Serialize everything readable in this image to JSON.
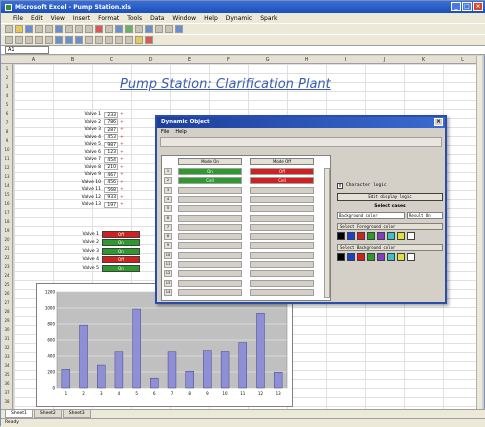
{
  "window": {
    "title": "Microsoft Excel - Pump Station.xls"
  },
  "menubar": [
    "File",
    "Edit",
    "View",
    "Insert",
    "Format",
    "Tools",
    "Data",
    "Window",
    "Help",
    "Dynamic",
    "Spark"
  ],
  "formula": {
    "namebox": "A1"
  },
  "columns": [
    "A",
    "B",
    "C",
    "D",
    "E",
    "F",
    "G",
    "H",
    "I",
    "J",
    "K",
    "L"
  ],
  "sheet": {
    "title": "Pump Station: Clarification Plant",
    "values": [
      {
        "label": "Valve 1",
        "value": "233",
        "mark": "+"
      },
      {
        "label": "Valve 2",
        "value": "786",
        "mark": "+"
      },
      {
        "label": "Valve 3",
        "value": "287",
        "mark": "+"
      },
      {
        "label": "Valve 4",
        "value": "453",
        "mark": "+"
      },
      {
        "label": "Valve 5",
        "value": "987",
        "mark": "+"
      },
      {
        "label": "Valve 6",
        "value": "123",
        "mark": "+"
      },
      {
        "label": "Valve 7",
        "value": "454",
        "mark": "+"
      },
      {
        "label": "Valve 8",
        "value": "210",
        "mark": "+"
      },
      {
        "label": "Valve 9",
        "value": "467",
        "mark": "+"
      },
      {
        "label": "Valve 10",
        "value": "456",
        "mark": "+"
      },
      {
        "label": "Valve 11",
        "value": "568",
        "mark": "+"
      },
      {
        "label": "Valve 12",
        "value": "933",
        "mark": "+"
      },
      {
        "label": "Valve 13",
        "value": "197",
        "mark": "+"
      }
    ],
    "statuses": [
      {
        "label": "Valve 1",
        "text": "Off",
        "color": "#d02020"
      },
      {
        "label": "Valve 2",
        "text": "On",
        "color": "#2e9a2e"
      },
      {
        "label": "Valve 3",
        "text": "On",
        "color": "#2e9a2e"
      },
      {
        "label": "Valve 4",
        "text": "Off",
        "color": "#d02020"
      },
      {
        "label": "Valve 5",
        "text": "On",
        "color": "#2e9a2e"
      }
    ]
  },
  "chart_data": {
    "type": "bar",
    "categories": [
      "1",
      "2",
      "3",
      "4",
      "5",
      "6",
      "7",
      "8",
      "9",
      "10",
      "11",
      "12",
      "13"
    ],
    "values": [
      233,
      786,
      287,
      453,
      987,
      123,
      454,
      210,
      467,
      456,
      568,
      933,
      197
    ],
    "ylim": [
      0,
      1200
    ],
    "yticks": [
      "0",
      "100",
      "200",
      "300",
      "400",
      "500",
      "600",
      "700",
      "800",
      "900",
      "1000",
      "1100",
      "1200"
    ],
    "bar_color": "#8f8fd8",
    "plot_bg": "#c0c0c0",
    "grid": true
  },
  "dialog": {
    "title": "Dynamic Object",
    "menu": [
      "File",
      "Help"
    ],
    "col1_header": "Mode  On",
    "col2_header": "Mode  Off",
    "rows": [
      {
        "n": "1",
        "c1": "On",
        "c1color": "#2e9a2e",
        "c2": "Off",
        "c2color": "#d02020"
      },
      {
        "n": "2",
        "c1": "Cell",
        "c1color": "#2e9a2e",
        "c2": "Cell",
        "c2color": "#d02020"
      },
      {
        "n": "3",
        "c1": "",
        "c1color": "",
        "c2": "",
        "c2color": ""
      },
      {
        "n": "4",
        "c1": "",
        "c1color": "",
        "c2": "",
        "c2color": ""
      },
      {
        "n": "5",
        "c1": "",
        "c1color": "",
        "c2": "",
        "c2color": ""
      },
      {
        "n": "6",
        "c1": "",
        "c1color": "",
        "c2": "",
        "c2color": ""
      },
      {
        "n": "7",
        "c1": "",
        "c1color": "",
        "c2": "",
        "c2color": ""
      },
      {
        "n": "8",
        "c1": "",
        "c1color": "",
        "c2": "",
        "c2color": ""
      },
      {
        "n": "9",
        "c1": "",
        "c1color": "",
        "c2": "",
        "c2color": ""
      },
      {
        "n": "10",
        "c1": "",
        "c1color": "",
        "c2": "",
        "c2color": ""
      },
      {
        "n": "11",
        "c1": "",
        "c1color": "",
        "c2": "",
        "c2color": ""
      },
      {
        "n": "12",
        "c1": "",
        "c1color": "",
        "c2": "",
        "c2color": ""
      },
      {
        "n": "13",
        "c1": "",
        "c1color": "",
        "c2": "",
        "c2color": ""
      },
      {
        "n": "14",
        "c1": "",
        "c1color": "",
        "c2": "",
        "c2color": ""
      }
    ],
    "check_label": "Character logic",
    "check_mark": "x",
    "button_label": "Edit display logic",
    "select_label": "Select cases",
    "field1": "Background color",
    "field2": "Result On",
    "fore_label": "Select Foreground color",
    "back_label": "Select Background color",
    "colors": [
      "#000000",
      "#1c3fcf",
      "#d02020",
      "#2e9a2e",
      "#8040c0",
      "#40c0c0",
      "#e0e040",
      "#ffffff"
    ]
  },
  "tabs": [
    "Sheet1",
    "Sheet2",
    "Sheet3"
  ],
  "status": {
    "text": "Ready"
  }
}
